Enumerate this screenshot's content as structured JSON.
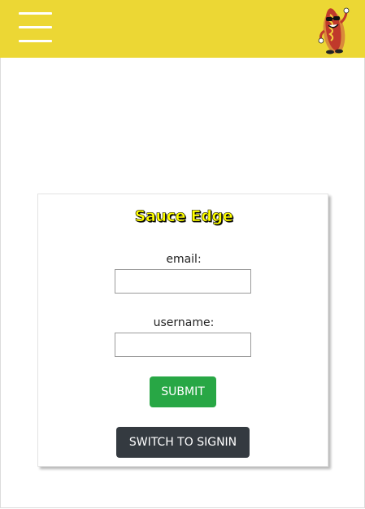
{
  "header": {
    "menu_icon": "hamburger-menu-icon",
    "logo_icon": "hotdog-mascot-icon",
    "bar_color": "#ecd734"
  },
  "form": {
    "title": "Sauce Edge",
    "email_label": "email:",
    "email_value": "",
    "username_label": "username:",
    "username_value": "",
    "submit_label": "SUBMIT",
    "switch_label": "SWITCH TO SIGNIN"
  },
  "colors": {
    "title_fill": "#ffff00",
    "submit_bg": "#28a745",
    "switch_bg": "#343a40"
  }
}
